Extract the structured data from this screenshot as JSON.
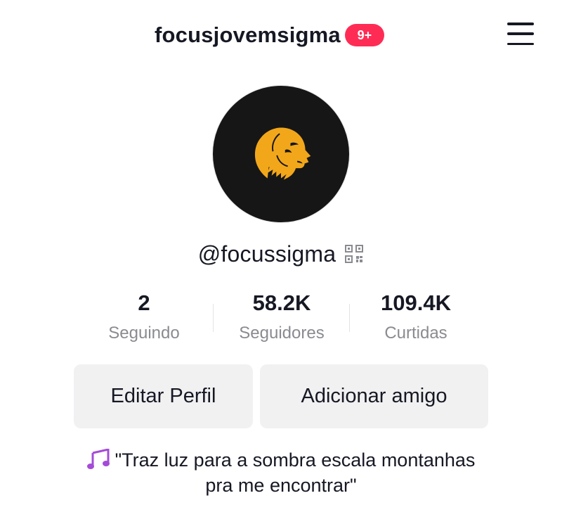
{
  "header": {
    "username": "focusjovemsigma",
    "notification_badge": "9+",
    "menu_icon": "hamburger-menu-icon"
  },
  "profile": {
    "avatar_icon": "lion-head-icon",
    "handle": "@focussigma",
    "qr_icon": "qr-code-icon"
  },
  "stats": [
    {
      "value": "2",
      "label": "Seguindo"
    },
    {
      "value": "58.2K",
      "label": "Seguidores"
    },
    {
      "value": "109.4K",
      "label": "Curtidas"
    }
  ],
  "actions": {
    "edit_profile_label": "Editar Perfil",
    "add_friend_label": "Adicionar amigo"
  },
  "bio": {
    "emoji_icon": "musical-notes-icon",
    "line1": "\"Traz luz para a sombra escala montanhas",
    "line2": "pra me encontrar\""
  },
  "colors": {
    "badge": "#fe2c55",
    "lion": "#f2a71b",
    "avatar_bg": "#161616",
    "button_bg": "#f1f1f2",
    "muted_text": "#8a8b91",
    "music_notes": "#a44bd8"
  }
}
